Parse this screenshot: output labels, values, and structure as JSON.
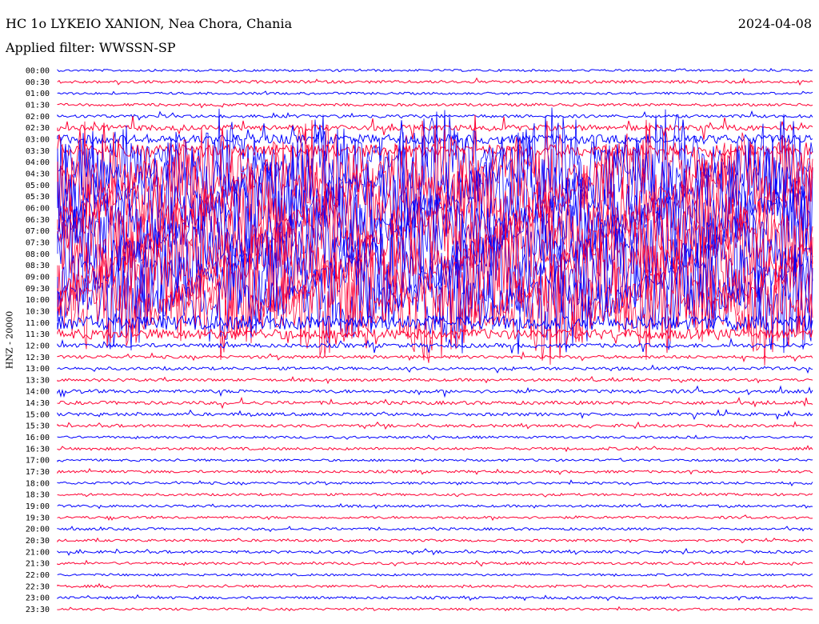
{
  "header": {
    "station": "HC 1o LYKEIO XANION, Nea Chora, Chania",
    "filter": "Applied filter: WWSSN-SP",
    "date": "2024-04-08"
  },
  "chart_data": {
    "type": "line",
    "title": "HC 1o LYKEIO XANION, Nea Chora, Chania",
    "subtitle": "Applied filter: WWSSN-SP",
    "date": "2024-04-08",
    "ylabel": "HNZ - 20000",
    "trace_colors": [
      "#0000ff",
      "#ff0033"
    ],
    "row_labels": [
      "00:00",
      "00:30",
      "01:00",
      "01:30",
      "02:00",
      "02:30",
      "03:00",
      "03:30",
      "04:00",
      "04:30",
      "05:00",
      "05:30",
      "06:00",
      "06:30",
      "07:00",
      "07:30",
      "08:00",
      "08:30",
      "09:00",
      "09:30",
      "10:00",
      "10:30",
      "11:00",
      "11:30",
      "12:00",
      "12:30",
      "13:00",
      "13:30",
      "14:00",
      "14:30",
      "15:00",
      "15:30",
      "16:00",
      "16:30",
      "17:00",
      "17:30",
      "18:00",
      "18:30",
      "19:00",
      "19:30",
      "20:00",
      "20:30",
      "21:00",
      "21:30",
      "22:00",
      "22:30",
      "23:00",
      "23:30"
    ],
    "relative_activity": [
      0.02,
      0.06,
      0.03,
      0.05,
      0.08,
      0.25,
      0.5,
      0.75,
      1.0,
      1.0,
      1.0,
      1.0,
      1.0,
      1.0,
      1.0,
      1.0,
      1.0,
      1.0,
      1.0,
      1.0,
      1.0,
      1.0,
      0.85,
      0.55,
      0.15,
      0.08,
      0.07,
      0.05,
      0.1,
      0.1,
      0.08,
      0.06,
      0.03,
      0.05,
      0.03,
      0.04,
      0.04,
      0.03,
      0.03,
      0.04,
      0.04,
      0.03,
      0.05,
      0.04,
      0.02,
      0.04,
      0.04,
      0.03
    ],
    "grid": false
  }
}
